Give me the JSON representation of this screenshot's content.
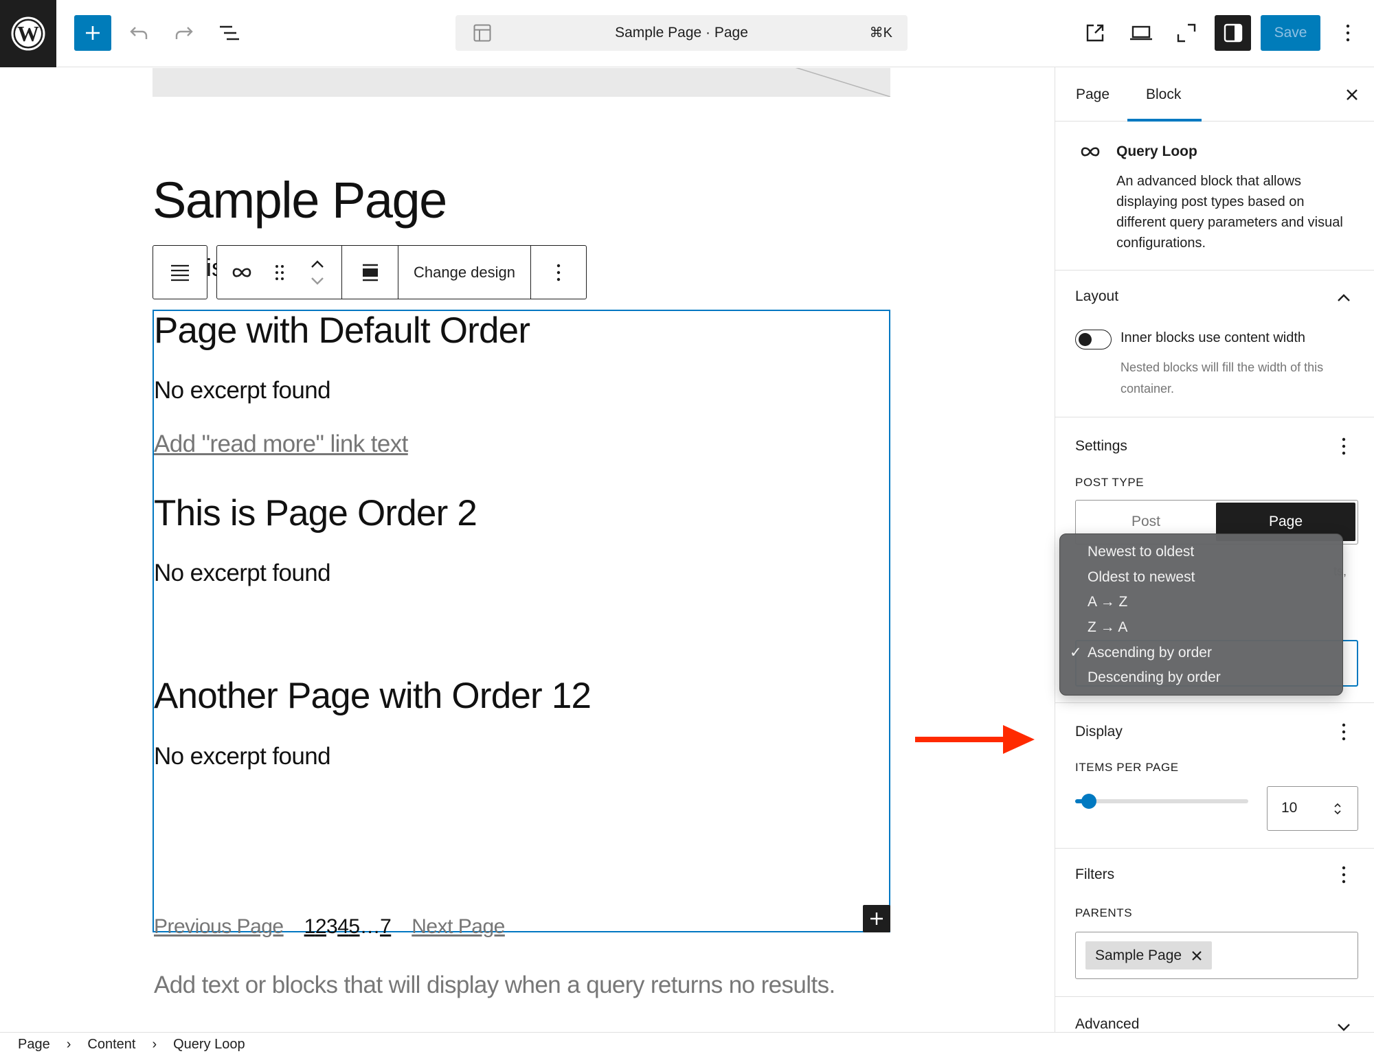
{
  "header": {
    "logo": "wordpress-logo",
    "inserter_label": "+",
    "command_bar": {
      "title": "Sample Page · Page",
      "shortcut": "⌘K"
    },
    "save_label": "Save",
    "icons": [
      "wordpress-icon",
      "plus-icon",
      "undo-icon",
      "redo-icon",
      "list-view-icon",
      "layout-icon",
      "external-link-icon",
      "laptop-preview-icon",
      "fullscreen-icon",
      "sidebar-toggle-icon",
      "more-vertical-icon"
    ]
  },
  "canvas": {
    "page_title": "Sample Page",
    "peek_text": "is",
    "block_toolbar": {
      "change_design_label": "Change design"
    },
    "query_loop": {
      "posts": [
        {
          "title": "Page with Default Order",
          "excerpt": "No excerpt found",
          "read_more": "Add \"read more\" link text"
        },
        {
          "title": "This is Page Order 2",
          "excerpt": "No excerpt found"
        },
        {
          "title": "Another Page with Order 12",
          "excerpt": "No excerpt found"
        }
      ],
      "pagination": {
        "previous": "Previous Page",
        "pages": [
          {
            "label": "1",
            "current": false
          },
          {
            "label": "2",
            "current": false
          },
          {
            "label": "3",
            "current": true
          },
          {
            "label": "4",
            "current": false
          },
          {
            "label": "5",
            "current": false
          },
          {
            "label": "…",
            "current": true
          },
          {
            "label": "7",
            "current": false
          }
        ],
        "next": "Next Page"
      },
      "no_results": "Add text or blocks that will display when a query returns no results."
    }
  },
  "sidebar": {
    "tabs": [
      {
        "label": "Page",
        "active": false
      },
      {
        "label": "Block",
        "active": true
      }
    ],
    "block_card": {
      "name": "Query Loop",
      "description": "An advanced block that allows displaying post types based on different query parameters and visual configurations."
    },
    "layout": {
      "heading": "Layout",
      "toggle_label": "Inner blocks use content width",
      "toggle_on": false,
      "help": "Nested blocks will fill the width of this container."
    },
    "settings": {
      "heading": "Settings",
      "post_type_label": "POST TYPE",
      "post_type_options": [
        "Post",
        "Page"
      ],
      "post_type_selected": "Page",
      "hidden_help_tail": "ts,"
    },
    "order_menu": {
      "options": [
        "Newest to oldest",
        "Oldest to newest",
        "A → Z",
        "Z → A",
        "Ascending by order",
        "Descending by order"
      ],
      "selected": "Ascending by order",
      "check": "✓"
    },
    "display": {
      "heading": "Display",
      "items_per_page_label": "ITEMS PER PAGE",
      "items_per_page": "10",
      "slider_fraction": 0.08
    },
    "filters": {
      "heading": "Filters",
      "parents_label": "PARENTS",
      "parents": [
        "Sample Page"
      ]
    },
    "advanced": {
      "heading": "Advanced"
    }
  },
  "footer": {
    "breadcrumb": [
      "Page",
      "Content",
      "Query Loop"
    ],
    "separator": "›"
  },
  "colors": {
    "accent": "#007cba",
    "selection_outline": "#0077c2",
    "annotation_arrow": "#ff2a00",
    "menu_bg": "#646567"
  }
}
